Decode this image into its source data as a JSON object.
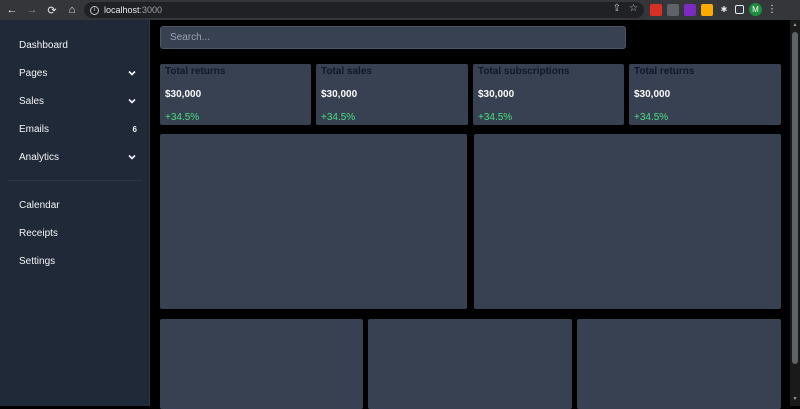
{
  "browser": {
    "back_icon": "←",
    "forward_icon": "→",
    "reload_icon": "⟳",
    "home_icon": "⌂",
    "url_host": "localhost",
    "url_port": ":3000",
    "share_icon": "⇪",
    "star_icon": "☆",
    "avatar_letter": "M"
  },
  "sidebar": {
    "items": [
      {
        "label": "Dashboard"
      },
      {
        "label": "Pages"
      },
      {
        "label": "Sales"
      },
      {
        "label": "Emails",
        "badge": "6"
      },
      {
        "label": "Analytics"
      },
      {
        "label": "Calendar"
      },
      {
        "label": "Receipts"
      },
      {
        "label": "Settings"
      }
    ]
  },
  "search": {
    "placeholder": "Search..."
  },
  "cards": [
    {
      "title": "Total returns",
      "value": "$30,000",
      "change": "+34.5%"
    },
    {
      "title": "Total sales",
      "value": "$30,000",
      "change": "+34.5%"
    },
    {
      "title": "Total subscriptions",
      "value": "$30,000",
      "change": "+34.5%"
    },
    {
      "title": "Total returns",
      "value": "$30,000",
      "change": "+34.5%"
    }
  ],
  "colors": {
    "sidebar_bg": "#1f2937",
    "panel_bg": "#374151",
    "positive": "#4ade80",
    "page_bg": "#000000"
  }
}
